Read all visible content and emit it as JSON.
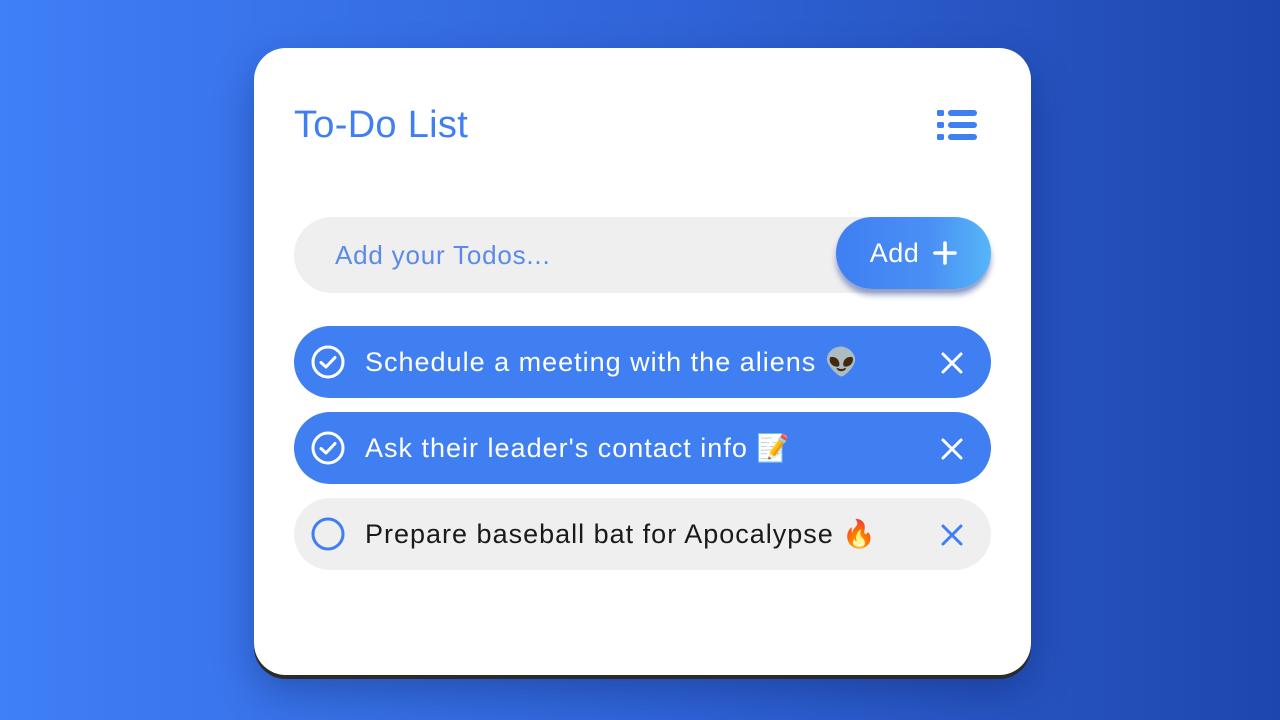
{
  "app": {
    "title": "To-Do List",
    "menu_icon": "list-icon"
  },
  "input": {
    "placeholder": "Add your Todos...",
    "value": ""
  },
  "add_button": {
    "label": "Add",
    "icon": "plus-icon"
  },
  "todos": [
    {
      "text": "Schedule a meeting with the aliens 👽",
      "completed": true
    },
    {
      "text": "Ask their leader's contact info 📝",
      "completed": true
    },
    {
      "text": "Prepare baseball bat for Apocalypse 🔥",
      "completed": false
    }
  ],
  "colors": {
    "accent": "#3f7ff2",
    "background_start": "#3f7ff7",
    "background_end": "#1e47ad",
    "item_bg": "#efefef",
    "card": "#ffffff"
  }
}
